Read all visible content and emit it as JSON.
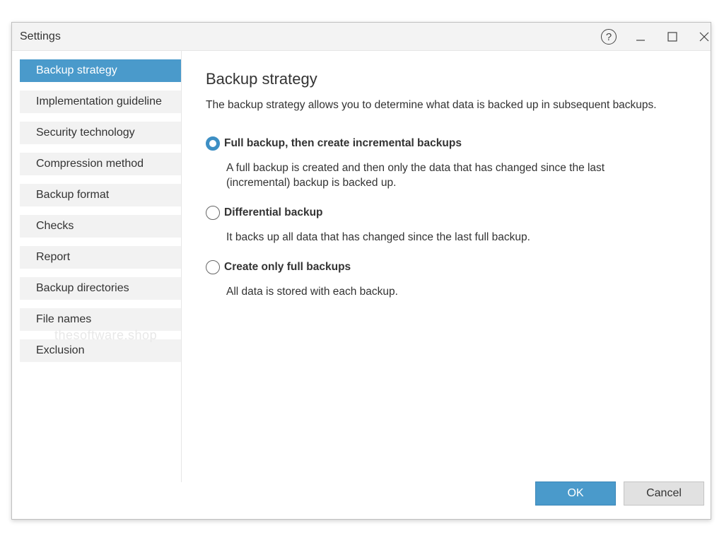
{
  "window": {
    "title": "Settings"
  },
  "titlebar_icons": {
    "help": "question-circle-icon",
    "minimize": "minimize-icon",
    "maximize": "maximize-icon",
    "close": "close-icon"
  },
  "sidebar": {
    "selected_index": 0,
    "items": [
      {
        "label": "Backup strategy"
      },
      {
        "label": "Implementation guideline"
      },
      {
        "label": "Security technology"
      },
      {
        "label": "Compression method"
      },
      {
        "label": "Backup format"
      },
      {
        "label": "Checks"
      },
      {
        "label": "Report"
      },
      {
        "label": "Backup directories"
      },
      {
        "label": "File names"
      },
      {
        "label": "Exclusion"
      }
    ],
    "watermark": "thesoftware.shop"
  },
  "main": {
    "title": "Backup strategy",
    "description": "The backup strategy allows you to determine what data is backed up in subsequent backups.",
    "selected_option": 0,
    "options": [
      {
        "label": "Full backup, then create incremental backups",
        "description": "A full backup is created and then only the data that has changed since the last (incremental) backup is backed up."
      },
      {
        "label": "Differential backup",
        "description": "It backs up all data that has changed since the last full backup."
      },
      {
        "label": "Create only full backups",
        "description": "All data is stored with each backup."
      }
    ]
  },
  "footer": {
    "ok_label": "OK",
    "cancel_label": "Cancel"
  },
  "colors": {
    "accent": "#4a9acb",
    "radio_selected": "#3d8fc4",
    "nav_background": "#f2f2f2",
    "cancel_background": "#e1e1e1"
  }
}
